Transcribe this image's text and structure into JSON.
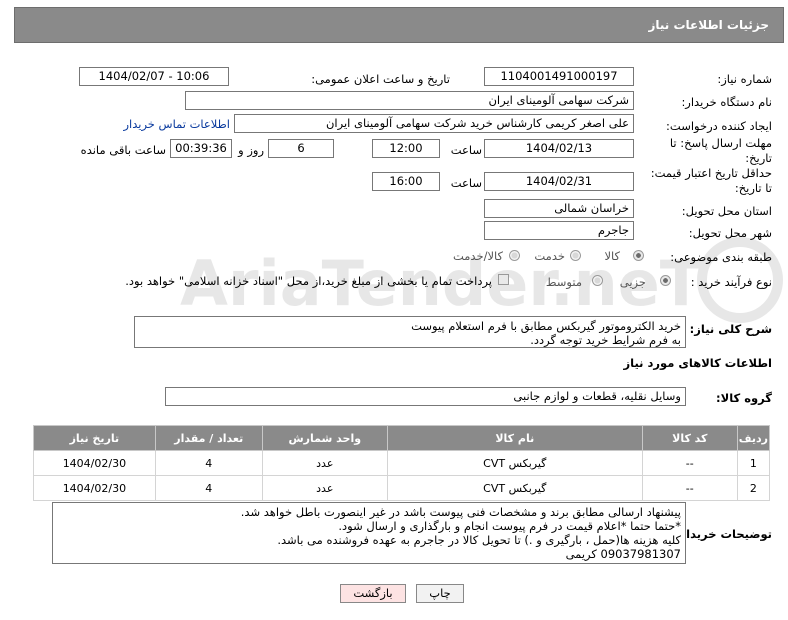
{
  "header": {
    "title": "جزئیات اطلاعات نیاز"
  },
  "labels": {
    "need_number": "شماره نیاز:",
    "announce_datetime": "تاریخ و ساعت اعلان عمومی:",
    "buyer_org": "نام دستگاه خریدار:",
    "requester": "ایجاد کننده درخواست:",
    "reply_deadline": "مهلت ارسال پاسخ: تا تاریخ:",
    "price_validity": "حداقل تاریخ اعتبار قیمت: تا تاریخ:",
    "province": "استان محل تحویل:",
    "city": "شهر محل تحویل:",
    "category": "طبقه بندی موضوعی:",
    "process_type": "نوع فرآیند خرید :",
    "time_word": "ساعت",
    "time_word2": "ساعت",
    "days_and": "روز و",
    "remaining": "ساعت باقی مانده",
    "general_desc": "شرح کلی نیاز:",
    "goods_info": "اطلاعات کالاهای مورد نیاز",
    "goods_group": "گروه کالا:",
    "buyer_notes": "توضیحات خریدار:"
  },
  "values": {
    "need_number": "1104001491000197",
    "announce_datetime": "1404/02/07 - 10:06",
    "buyer_org": "شرکت سهامی آلومینای ایران",
    "requester": "علی اصغر کریمی کارشناس خرید شرکت سهامی آلومینای ایران",
    "contact_link": "اطلاعات تماس خریدار",
    "reply_date": "1404/02/13",
    "reply_time": "12:00",
    "days": "6",
    "remaining_time": "00:39:36",
    "validity_date": "1404/02/31",
    "validity_time": "16:00",
    "province": "خراسان شمالی",
    "city": "جاجرم",
    "general_desc": "خرید الکتروموتور گیربکس مطابق با فرم استعلام پیوست\nبه فرم شرایط خرید توجه گردد.",
    "goods_group": "وسایل نقلیه، قطعات و لوازم جانبی",
    "buyer_notes": "پیشنهاد ارسالی مطابق برند و مشخصات فنی پیوست باشد در غیر اینصورت باطل خواهد شد.\n*حتما حتما *اعلام قیمت در فرم پیوست انجام و بارگذاری و ارسال شود.\nکلیه هزینه ها(حمل ، بارگیری و .) تا تحویل کالا در جاجرم به عهده فروشنده می باشد.\n09037981307 کریمی"
  },
  "category_options": {
    "goods": "کالا",
    "service": "خدمت",
    "goods_service": "کالا/خدمت",
    "selected": "کالا"
  },
  "process_options": {
    "minor": "جزیی",
    "medium": "متوسط",
    "payment_note": "پرداخت تمام یا بخشی از مبلغ خرید،از محل \"اسناد خزانه اسلامی\" خواهد بود.",
    "selected": "جزیی"
  },
  "table": {
    "headers": [
      "ردیف",
      "کد کالا",
      "نام کالا",
      "واحد شمارش",
      "تعداد / مقدار",
      "تاریخ نیاز"
    ],
    "rows": [
      [
        "1",
        "--",
        "گیربکس CVT",
        "عدد",
        "4",
        "1404/02/30"
      ],
      [
        "2",
        "--",
        "گیربکس CVT",
        "عدد",
        "4",
        "1404/02/30"
      ]
    ]
  },
  "buttons": {
    "print": "چاپ",
    "back": "بازگشت"
  },
  "watermark": "AriaTender.neT",
  "colors": {
    "header_bg": "#8a8a8a",
    "back_button_bg": "#fde3e3",
    "print_button_bg": "#f2f2f2"
  }
}
